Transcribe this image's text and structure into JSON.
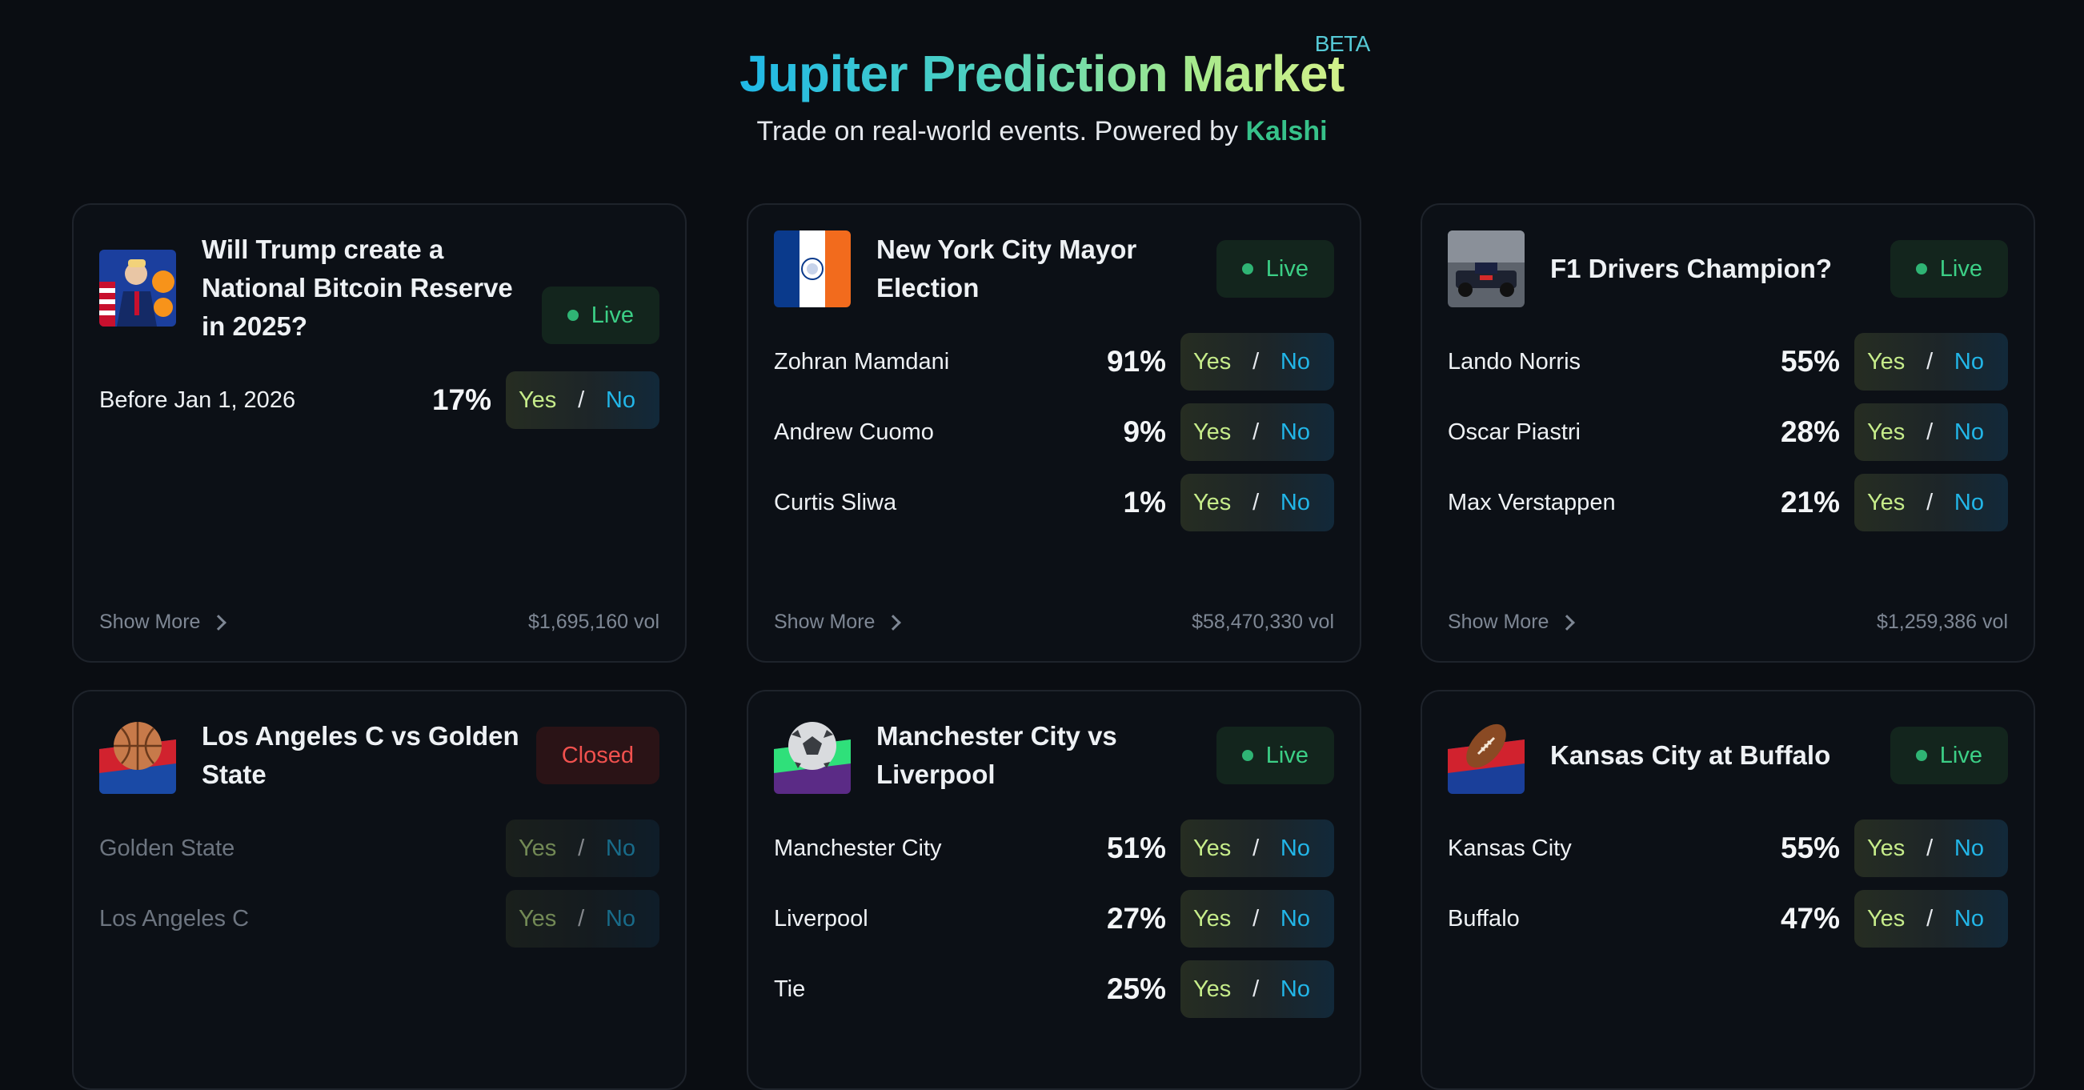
{
  "header": {
    "title": "Jupiter Prediction Market",
    "beta": "BETA",
    "subtitle": "Trade on real-world events. Powered by",
    "brand": "Kalshi"
  },
  "colors": {
    "live": "#3ccf86",
    "closed": "#f0514e",
    "yes": "#c6ec8a",
    "no": "#22b6e8"
  },
  "cards": [
    {
      "title": "Will Trump create a National Bitcoin Reserve in 2025?",
      "status": "Live",
      "icon": "trump-bitcoin-image",
      "rows": [
        {
          "name": "Before Jan 1, 2026",
          "pct": "17%",
          "yes": "Yes",
          "sep": "/",
          "no": "No"
        }
      ],
      "show_more": "Show More",
      "volume": "$1,695,160 vol"
    },
    {
      "title": "New York City Mayor Election",
      "status": "Live",
      "icon": "nyc-flag-image",
      "rows": [
        {
          "name": "Zohran Mamdani",
          "pct": "91%",
          "yes": "Yes",
          "sep": "/",
          "no": "No"
        },
        {
          "name": "Andrew Cuomo",
          "pct": "9%",
          "yes": "Yes",
          "sep": "/",
          "no": "No"
        },
        {
          "name": "Curtis Sliwa",
          "pct": "1%",
          "yes": "Yes",
          "sep": "/",
          "no": "No"
        }
      ],
      "show_more": "Show More",
      "volume": "$58,470,330 vol"
    },
    {
      "title": "F1 Drivers Champion?",
      "status": "Live",
      "icon": "f1-car-image",
      "rows": [
        {
          "name": "Lando Norris",
          "pct": "55%",
          "yes": "Yes",
          "sep": "/",
          "no": "No"
        },
        {
          "name": "Oscar Piastri",
          "pct": "28%",
          "yes": "Yes",
          "sep": "/",
          "no": "No"
        },
        {
          "name": "Max Verstappen",
          "pct": "21%",
          "yes": "Yes",
          "sep": "/",
          "no": "No"
        }
      ],
      "show_more": "Show More",
      "volume": "$1,259,386 vol"
    },
    {
      "title": "Los Angeles C vs Golden State",
      "status": "Closed",
      "icon": "basketball-icon",
      "rows": [
        {
          "name": "Golden State",
          "pct": "",
          "yes": "Yes",
          "sep": "/",
          "no": "No"
        },
        {
          "name": "Los Angeles C",
          "pct": "",
          "yes": "Yes",
          "sep": "/",
          "no": "No"
        }
      ]
    },
    {
      "title": "Manchester City vs Liverpool",
      "status": "Live",
      "icon": "soccer-ball-icon",
      "rows": [
        {
          "name": "Manchester City",
          "pct": "51%",
          "yes": "Yes",
          "sep": "/",
          "no": "No"
        },
        {
          "name": "Liverpool",
          "pct": "27%",
          "yes": "Yes",
          "sep": "/",
          "no": "No"
        },
        {
          "name": "Tie",
          "pct": "25%",
          "yes": "Yes",
          "sep": "/",
          "no": "No"
        }
      ]
    },
    {
      "title": "Kansas City at Buffalo",
      "status": "Live",
      "icon": "football-icon",
      "rows": [
        {
          "name": "Kansas City",
          "pct": "55%",
          "yes": "Yes",
          "sep": "/",
          "no": "No"
        },
        {
          "name": "Buffalo",
          "pct": "47%",
          "yes": "Yes",
          "sep": "/",
          "no": "No"
        }
      ]
    }
  ]
}
